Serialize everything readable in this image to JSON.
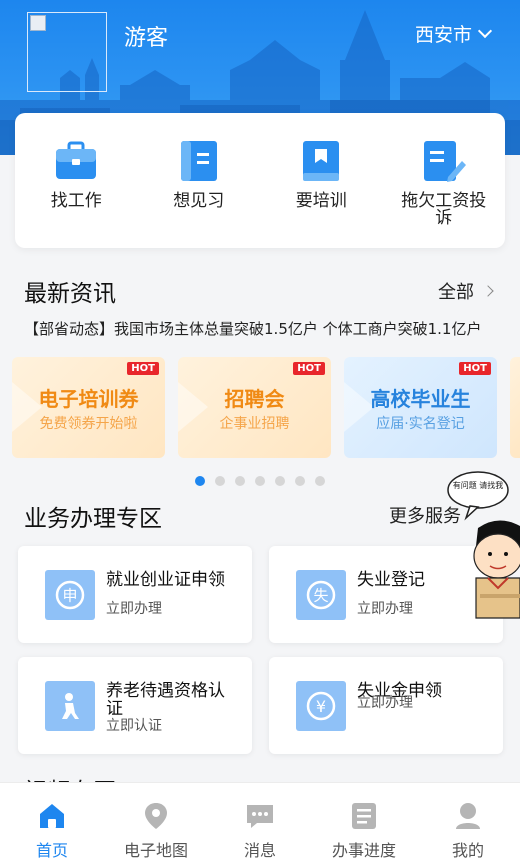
{
  "header": {
    "user_name": "游客",
    "city": "西安市",
    "brand_color": "#1e86ef"
  },
  "quick_entries": [
    {
      "label": "找工作",
      "icon": "briefcase-icon"
    },
    {
      "label": "想见习",
      "icon": "book-icon"
    },
    {
      "label": "要培训",
      "icon": "bookmark-book-icon"
    },
    {
      "label": "拖欠工资投诉",
      "icon": "edit-document-icon"
    }
  ],
  "news": {
    "title": "最新资讯",
    "more_label": "全部",
    "headline": "【部省动态】我国市场主体总量突破1.5亿户 个体工商户突破1.1亿户"
  },
  "banners": [
    {
      "title": "电子培训券",
      "subtitle": "免费领券开始啦",
      "badge": "HOT"
    },
    {
      "title": "招聘会",
      "subtitle": "企事业招聘",
      "badge": "HOT"
    },
    {
      "title": "高校毕业生",
      "subtitle": "应届·实名登记",
      "badge": "HOT"
    }
  ],
  "carousel": {
    "count": 7,
    "active_index": 0
  },
  "services": {
    "title": "业务办理专区",
    "more_label": "更多服务",
    "helper_text": "有问题 请找我",
    "items": [
      {
        "title": "就业创业证申领",
        "action": "立即办理",
        "icon": "shen-icon",
        "glyph": "申"
      },
      {
        "title": "失业登记",
        "action": "立即办理",
        "icon": "shi-icon",
        "glyph": "失"
      },
      {
        "title": "养老待遇资格认证",
        "action": "立即认证",
        "icon": "elderly-icon",
        "glyph": ""
      },
      {
        "title": "失业金申领",
        "action": "立即办理",
        "icon": "yen-icon",
        "glyph": "¥"
      }
    ]
  },
  "next_section_title": "视频专区",
  "tabbar": [
    {
      "label": "首页",
      "icon": "home-icon",
      "active": true
    },
    {
      "label": "电子地图",
      "icon": "map-pin-icon",
      "active": false
    },
    {
      "label": "消息",
      "icon": "message-icon",
      "active": false
    },
    {
      "label": "办事进度",
      "icon": "progress-list-icon",
      "active": false
    },
    {
      "label": "我的",
      "icon": "user-icon",
      "active": false
    }
  ]
}
